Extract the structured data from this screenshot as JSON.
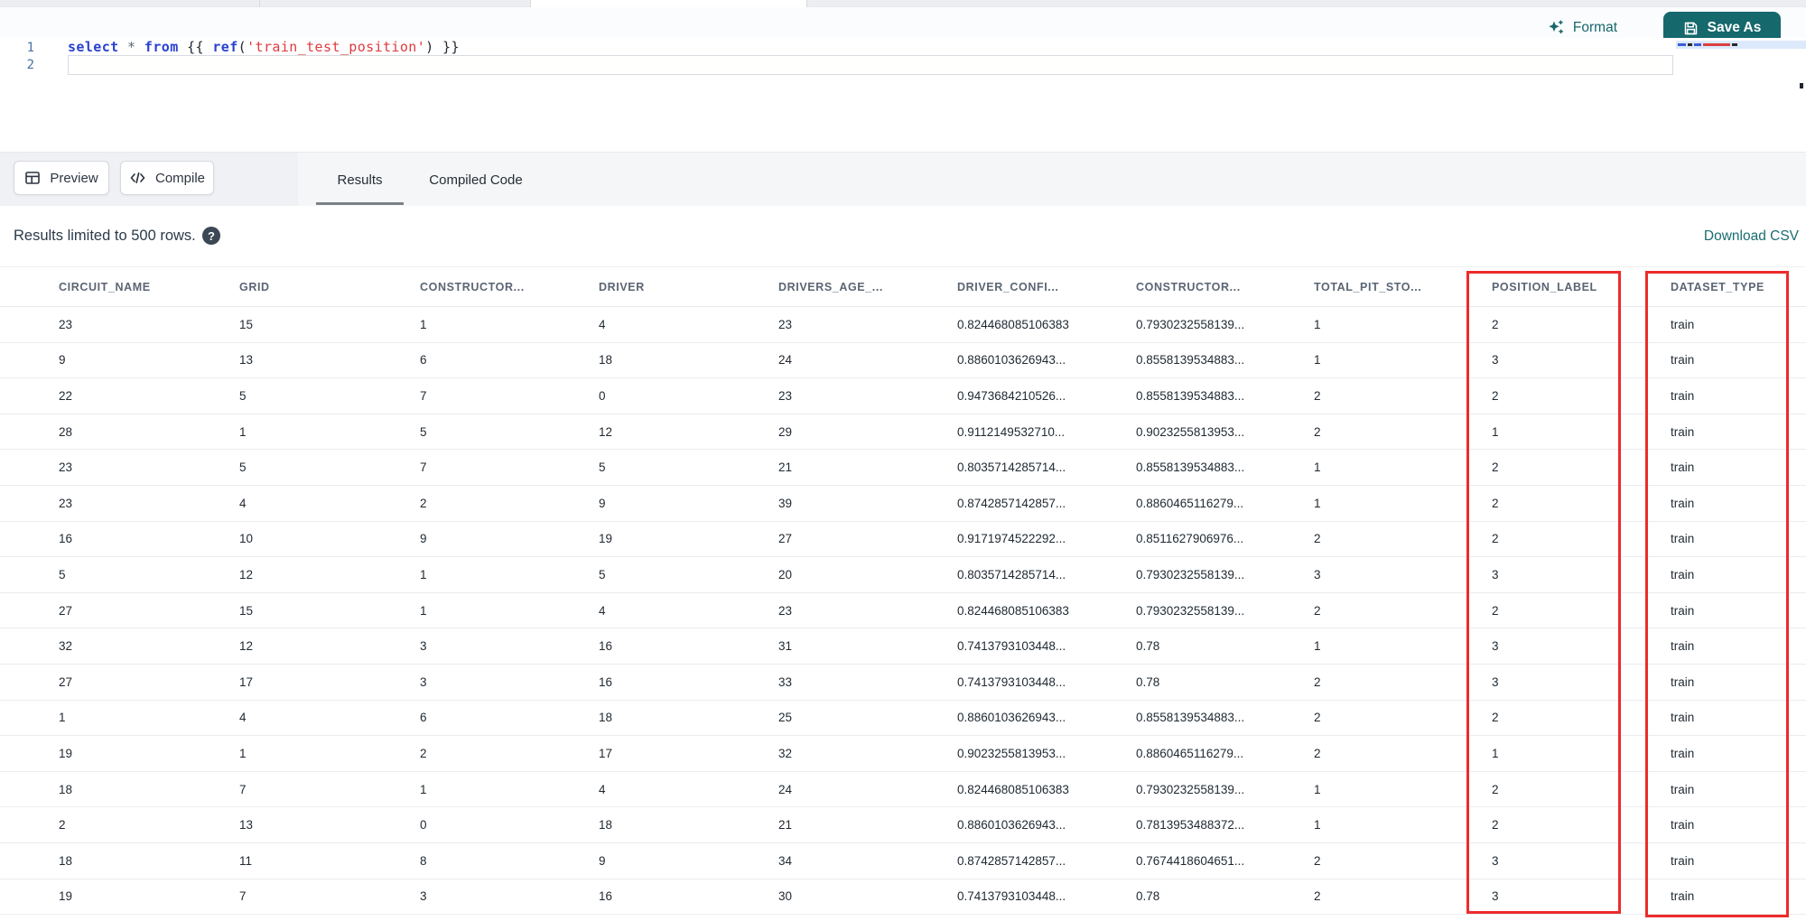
{
  "editor_toolbar": {
    "format_label": "Format",
    "save_as_label": "Save As"
  },
  "editor": {
    "line_numbers": [
      "1",
      "2"
    ],
    "code_tokens": [
      {
        "text": "select",
        "type": "kw"
      },
      {
        "text": " ",
        "type": "p"
      },
      {
        "text": "*",
        "type": "op"
      },
      {
        "text": " ",
        "type": "p"
      },
      {
        "text": "from",
        "type": "kw"
      },
      {
        "text": " {{ ",
        "type": "p"
      },
      {
        "text": "ref",
        "type": "kw"
      },
      {
        "text": "(",
        "type": "p"
      },
      {
        "text": "'train_test_position'",
        "type": "str"
      },
      {
        "text": ")",
        "type": "p"
      },
      {
        "text": " }}",
        "type": "p"
      }
    ]
  },
  "actions": {
    "preview_label": "Preview",
    "compile_label": "Compile"
  },
  "tabs": [
    {
      "label": "Results",
      "active": true
    },
    {
      "label": "Compiled Code",
      "active": false
    }
  ],
  "results_bar": {
    "info": "Results limited to 500 rows.",
    "download_label": "Download CSV"
  },
  "icons": {
    "help_glyph": "?"
  },
  "table": {
    "columns": [
      "CIRCUIT_NAME",
      "GRID",
      "CONSTRUCTOR...",
      "DRIVER",
      "DRIVERS_AGE_...",
      "DRIVER_CONFI...",
      "CONSTRUCTOR...",
      "TOTAL_PIT_STO...",
      "POSITION_LABEL",
      "DATASET_TYPE"
    ],
    "rows": [
      [
        "23",
        "15",
        "1",
        "4",
        "23",
        "0.824468085106383",
        "0.7930232558139...",
        "1",
        "2",
        "train"
      ],
      [
        "9",
        "13",
        "6",
        "18",
        "24",
        "0.8860103626943...",
        "0.8558139534883...",
        "1",
        "3",
        "train"
      ],
      [
        "22",
        "5",
        "7",
        "0",
        "23",
        "0.9473684210526...",
        "0.8558139534883...",
        "2",
        "2",
        "train"
      ],
      [
        "28",
        "1",
        "5",
        "12",
        "29",
        "0.9112149532710...",
        "0.9023255813953...",
        "2",
        "1",
        "train"
      ],
      [
        "23",
        "5",
        "7",
        "5",
        "21",
        "0.8035714285714...",
        "0.8558139534883...",
        "1",
        "2",
        "train"
      ],
      [
        "23",
        "4",
        "2",
        "9",
        "39",
        "0.8742857142857...",
        "0.8860465116279...",
        "1",
        "2",
        "train"
      ],
      [
        "16",
        "10",
        "9",
        "19",
        "27",
        "0.9171974522292...",
        "0.8511627906976...",
        "2",
        "2",
        "train"
      ],
      [
        "5",
        "12",
        "1",
        "5",
        "20",
        "0.8035714285714...",
        "0.7930232558139...",
        "3",
        "3",
        "train"
      ],
      [
        "27",
        "15",
        "1",
        "4",
        "23",
        "0.824468085106383",
        "0.7930232558139...",
        "2",
        "2",
        "train"
      ],
      [
        "32",
        "12",
        "3",
        "16",
        "31",
        "0.7413793103448...",
        "0.78",
        "1",
        "3",
        "train"
      ],
      [
        "27",
        "17",
        "3",
        "16",
        "33",
        "0.7413793103448...",
        "0.78",
        "2",
        "3",
        "train"
      ],
      [
        "1",
        "4",
        "6",
        "18",
        "25",
        "0.8860103626943...",
        "0.8558139534883...",
        "2",
        "2",
        "train"
      ],
      [
        "19",
        "1",
        "2",
        "17",
        "32",
        "0.9023255813953...",
        "0.8860465116279...",
        "2",
        "1",
        "train"
      ],
      [
        "18",
        "7",
        "1",
        "4",
        "24",
        "0.824468085106383",
        "0.7930232558139...",
        "1",
        "2",
        "train"
      ],
      [
        "2",
        "13",
        "0",
        "18",
        "21",
        "0.8860103626943...",
        "0.7813953488372...",
        "1",
        "2",
        "train"
      ],
      [
        "18",
        "11",
        "8",
        "9",
        "34",
        "0.8742857142857...",
        "0.7674418604651...",
        "2",
        "3",
        "train"
      ],
      [
        "19",
        "7",
        "3",
        "16",
        "30",
        "0.7413793103448...",
        "0.78",
        "2",
        "3",
        "train"
      ]
    ],
    "highlights": {
      "columns": [
        "POSITION_LABEL",
        "DATASET_TYPE"
      ],
      "color": "#ee2b2b"
    }
  },
  "colors": {
    "accent_teal": "#15686c",
    "highlight_red": "#ee2b2b",
    "keyword_blue": "#2942d1",
    "string_red": "#de3b3f"
  }
}
